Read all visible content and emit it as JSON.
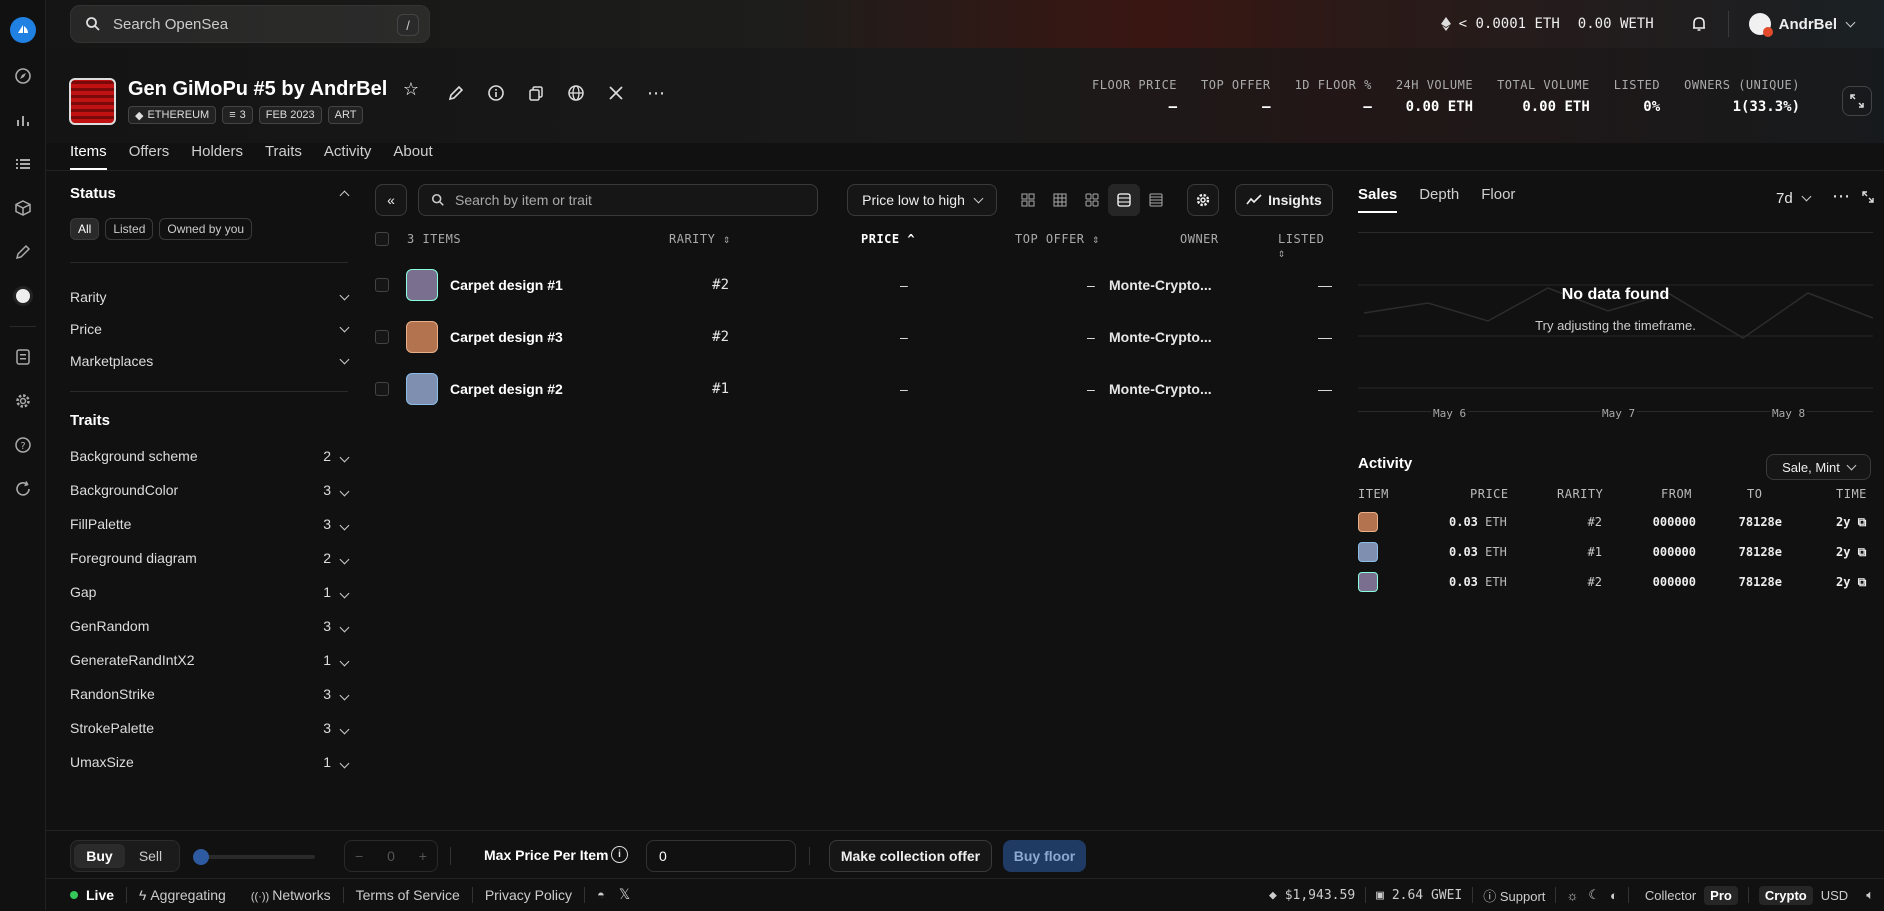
{
  "top": {
    "search_placeholder": "Search OpenSea",
    "search_shortcut": "/",
    "eth_balance": "< 0.0001 ETH",
    "weth_balance": "0.00 WETH",
    "username": "AndrBel"
  },
  "collection": {
    "title": "Gen GiMoPu #5 by AndrBel",
    "chips": [
      "ETHEREUM",
      "3",
      "FEB 2023",
      "ART"
    ],
    "stats": [
      {
        "label": "FLOOR PRICE",
        "value": "–"
      },
      {
        "label": "TOP OFFER",
        "value": "–"
      },
      {
        "label": "1D FLOOR %",
        "value": "–"
      },
      {
        "label": "24H VOLUME",
        "value": "0.00 ETH"
      },
      {
        "label": "TOTAL VOLUME",
        "value": "0.00 ETH"
      },
      {
        "label": "LISTED",
        "value": "0%"
      },
      {
        "label": "OWNERS (UNIQUE)",
        "value": "1(33.3%)"
      }
    ],
    "tabs": [
      "Items",
      "Offers",
      "Holders",
      "Traits",
      "Activity",
      "About"
    ]
  },
  "filters": {
    "status_title": "Status",
    "status_pills": [
      "All",
      "Listed",
      "Owned by you"
    ],
    "facets": [
      "Rarity",
      "Price",
      "Marketplaces"
    ],
    "traits_title": "Traits",
    "traits": [
      {
        "name": "Background scheme",
        "count": "2"
      },
      {
        "name": "BackgroundColor",
        "count": "3"
      },
      {
        "name": "FillPalette",
        "count": "3"
      },
      {
        "name": "Foreground diagram",
        "count": "2"
      },
      {
        "name": "Gap",
        "count": "1"
      },
      {
        "name": "GenRandom",
        "count": "3"
      },
      {
        "name": "GenerateRandIntX2",
        "count": "1"
      },
      {
        "name": "RandonStrike",
        "count": "3"
      },
      {
        "name": "StrokePalette",
        "count": "3"
      },
      {
        "name": "UmaxSize",
        "count": "1"
      }
    ]
  },
  "items": {
    "search_placeholder": "Search by item or trait",
    "sort_label": "Price low to high",
    "insights_label": "Insights",
    "header": {
      "count": "3 ITEMS",
      "rarity": "RARITY",
      "price": "PRICE",
      "top_offer": "TOP OFFER",
      "owner": "OWNER",
      "listed": "LISTED"
    },
    "rows": [
      {
        "name": "Carpet design #1",
        "rarity": "#2",
        "price": "–",
        "top_offer": "–",
        "owner": "Monte-Crypto...",
        "listed": "—",
        "color": "#7a6f8f"
      },
      {
        "name": "Carpet design #3",
        "rarity": "#2",
        "price": "–",
        "top_offer": "–",
        "owner": "Monte-Crypto...",
        "listed": "—",
        "color": "#b4734f"
      },
      {
        "name": "Carpet design #2",
        "rarity": "#1",
        "price": "–",
        "top_offer": "–",
        "owner": "Monte-Crypto...",
        "listed": "—",
        "color": "#7f8fb0"
      }
    ]
  },
  "side": {
    "tabs": [
      "Sales",
      "Depth",
      "Floor"
    ],
    "range": "7d",
    "no_data_title": "No data found",
    "no_data_sub": "Try adjusting the timeframe.",
    "x_ticks": [
      "May 6",
      "May 7",
      "May 8"
    ],
    "activity_title": "Activity",
    "activity_filter": "Sale, Mint",
    "activity_header": [
      "ITEM",
      "PRICE",
      "RARITY",
      "FROM",
      "TO",
      "TIME"
    ],
    "activity_rows": [
      {
        "price": "0.03",
        "unit": "ETH",
        "rarity": "#2",
        "from": "000000",
        "to": "78128e",
        "time": "2y",
        "color": "#b4734f"
      },
      {
        "price": "0.03",
        "unit": "ETH",
        "rarity": "#1",
        "from": "000000",
        "to": "78128e",
        "time": "2y",
        "color": "#7f8fb0"
      },
      {
        "price": "0.03",
        "unit": "ETH",
        "rarity": "#2",
        "from": "000000",
        "to": "78128e",
        "time": "2y",
        "color": "#7a6f8f"
      }
    ]
  },
  "bottom": {
    "buy": "Buy",
    "sell": "Sell",
    "qty": "0",
    "max_price_label": "Max Price Per Item",
    "max_price_value": "0",
    "collection_offer": "Make collection offer",
    "buy_floor": "Buy floor"
  },
  "footer": {
    "live": "Live",
    "aggregating": "Aggregating",
    "networks": "Networks",
    "terms": "Terms of Service",
    "privacy": "Privacy Policy",
    "eth_price": "$1,943.59",
    "gas": "2.64 GWEI",
    "support": "Support",
    "collector": "Collector",
    "pro": "Pro",
    "crypto": "Crypto",
    "usd": "USD"
  }
}
